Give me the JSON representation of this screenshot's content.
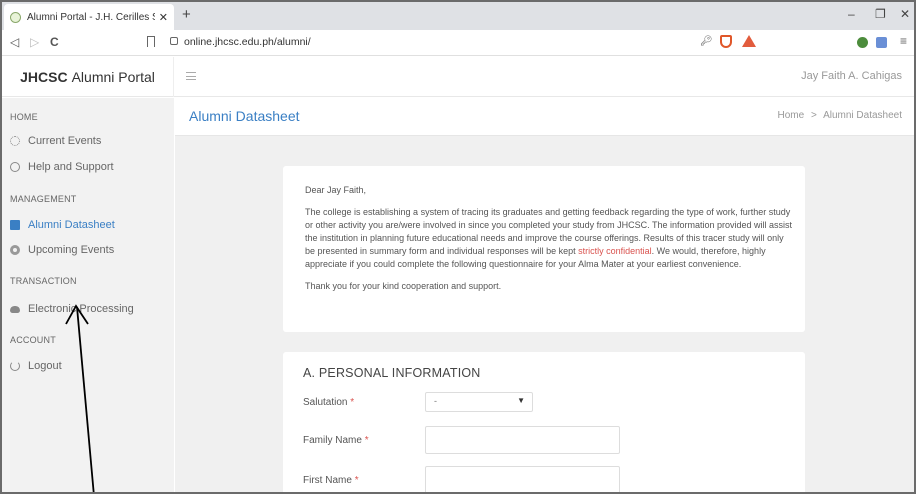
{
  "browser": {
    "tab_title": "Alumni Portal - J.H. Cerilles State C",
    "tab_close": "✕",
    "new_tab": "+",
    "url": "online.jhcsc.edu.ph/alumni/",
    "nav_icons": [
      "back-icon",
      "forward-icon",
      "reload-icon"
    ],
    "window_controls": [
      "–",
      "❐",
      "✕"
    ]
  },
  "header": {
    "brand_bold": "JHCSC",
    "brand_rest": "Alumni Portal",
    "user": "Jay Faith A. Cahigas"
  },
  "sidebar": {
    "home_head": "HOME",
    "items_home": [
      {
        "label": "Current Events",
        "icon": "gear-icon"
      },
      {
        "label": "Help and Support",
        "icon": "help-icon"
      }
    ],
    "mgmt_head": "MANAGEMENT",
    "items_mgmt": [
      {
        "label": "Alumni Datasheet",
        "icon": "document-icon"
      },
      {
        "label": "Upcoming Events",
        "icon": "event-icon"
      }
    ],
    "trans_head": "TRANSACTION",
    "items_trans": [
      {
        "label": "Electronic Processing",
        "icon": "cloud-icon"
      }
    ],
    "account_head": "ACCOUNT",
    "items_account": [
      {
        "label": "Logout",
        "icon": "power-icon"
      }
    ]
  },
  "page": {
    "title": "Alumni Datasheet",
    "crumb_home": "Home",
    "crumb_sep": ">",
    "crumb_current": "Alumni Datasheet"
  },
  "letter": {
    "greeting": "Dear Jay Faith,",
    "body_before": "The college is establishing a system of tracing its graduates and getting feedback regarding the type of work, further study or other activity you are/were involved in since you completed your study from JHCSC. The information provided will assist the institution in planning future educational needs and improve the course offerings. Results of this tracer study will only be presented in summary form and individual responses will be kept ",
    "body_highlight": "strictly confidential",
    "body_after": ". We would, therefore, highly appreciate if you could complete the following questionnaire for your Alma Mater at your earliest convenience.",
    "thanks": "Thank you for your kind cooperation and support."
  },
  "form": {
    "section_title": "A. PERSONAL INFORMATION",
    "salutation_label": "Salutation",
    "salutation_value": "-",
    "family_name_label": "Family Name",
    "first_name_label": "First Name",
    "required_mark": "*",
    "family_name_value": "",
    "first_name_value": ""
  },
  "colors": {
    "accent": "#3a7fc4",
    "required": "#d9534f",
    "sidebar_bg": "#f2f2f2",
    "content_bg": "#f0f0f0"
  }
}
